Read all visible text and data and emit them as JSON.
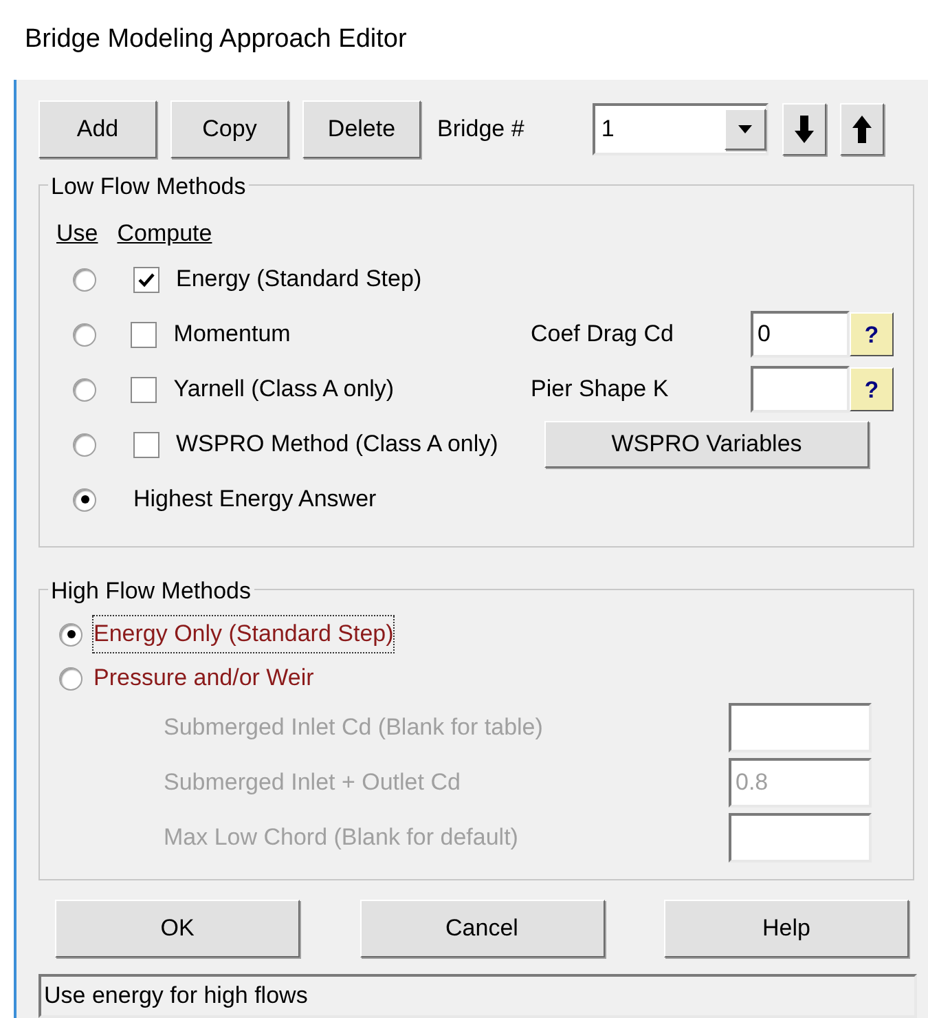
{
  "window": {
    "title": "Bridge Modeling Approach Editor"
  },
  "toolbar": {
    "buttons": [
      "Add",
      "Copy",
      "Delete"
    ],
    "bridge_label": "Bridge #",
    "bridge_value": "1"
  },
  "low_flow": {
    "title": "Low Flow Methods",
    "use_header": "Use",
    "compute_header": "Compute",
    "methods": [
      {
        "label": "Energy (Standard Step)",
        "selected": false,
        "checked": true
      },
      {
        "label": "Momentum",
        "selected": false,
        "checked": false,
        "field": {
          "label": "Coef Drag Cd",
          "value": "0",
          "help": "?"
        }
      },
      {
        "label": "Yarnell (Class A only)",
        "selected": false,
        "checked": false,
        "field": {
          "label": "Pier Shape K",
          "help": "?"
        }
      },
      {
        "label": "WSPRO Method (Class A only)",
        "selected": false,
        "checked": false,
        "button": "WSPRO Variables"
      }
    ],
    "highest": {
      "label": "Highest Energy Answer",
      "selected": true
    }
  },
  "high_flow": {
    "title": "High Flow Methods",
    "options": [
      {
        "label": "Energy Only (Standard Step)",
        "selected": true,
        "focused": true
      },
      {
        "label": "Pressure and/or Weir",
        "selected": false,
        "focused": false
      }
    ],
    "fields": [
      {
        "label": "Submerged Inlet Cd (Blank for table)",
        "disabled": true
      },
      {
        "label": "Submerged Inlet + Outlet Cd",
        "value": "0.8",
        "disabled": true
      },
      {
        "label": "Max Low Chord (Blank for default)",
        "disabled": true
      }
    ]
  },
  "buttons": [
    "OK",
    "Cancel",
    "Help"
  ],
  "status_bar": "Use energy for high flows"
}
